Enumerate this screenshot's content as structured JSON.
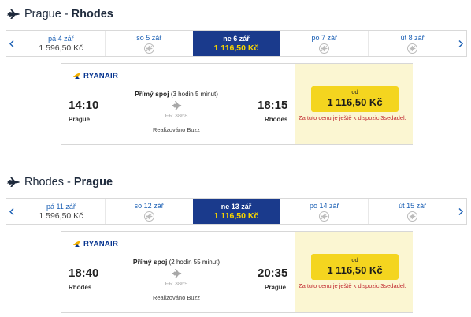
{
  "outbound": {
    "route_from": "Prague",
    "route_sep": " - ",
    "route_to": "Rhodes",
    "dates": [
      {
        "date": "pá 4 zář",
        "price": "1 596,50 Kč",
        "selected": false,
        "no_flight": false
      },
      {
        "date": "so 5 zář",
        "price": "",
        "selected": false,
        "no_flight": true
      },
      {
        "date": "ne 6 zář",
        "price": "1 116,50 Kč",
        "selected": true,
        "no_flight": false
      },
      {
        "date": "po 7 zář",
        "price": "",
        "selected": false,
        "no_flight": true
      },
      {
        "date": "út 8 zář",
        "price": "",
        "selected": false,
        "no_flight": true
      }
    ],
    "airline": "RYANAIR",
    "dep_time": "14:10",
    "dep_city": "Prague",
    "arr_time": "18:15",
    "arr_city": "Rhodes",
    "direct_label": "Přímý spoj",
    "duration": "(3 hodin 5 minut)",
    "flight_no": "FR 3868",
    "operated_by": "Realizováno Buzz",
    "price_from": "od",
    "price": "1 116,50 Kč",
    "availability": "Za tuto cenu je ještě k dispozici3sedadel."
  },
  "inbound": {
    "route_from": "Rhodes",
    "route_sep": " - ",
    "route_to": "Prague",
    "dates": [
      {
        "date": "pá 11 zář",
        "price": "1 596,50 Kč",
        "selected": false,
        "no_flight": false
      },
      {
        "date": "so 12 zář",
        "price": "",
        "selected": false,
        "no_flight": true
      },
      {
        "date": "ne 13 zář",
        "price": "1 116,50 Kč",
        "selected": true,
        "no_flight": false
      },
      {
        "date": "po 14 zář",
        "price": "",
        "selected": false,
        "no_flight": true
      },
      {
        "date": "út 15 zář",
        "price": "",
        "selected": false,
        "no_flight": true
      }
    ],
    "airline": "RYANAIR",
    "dep_time": "18:40",
    "dep_city": "Rhodes",
    "arr_time": "20:35",
    "arr_city": "Prague",
    "direct_label": "Přímý spoj",
    "duration": "(2 hodin 55 minut)",
    "flight_no": "FR 3869",
    "operated_by": "Realizováno Buzz",
    "price_from": "od",
    "price": "1 116,50 Kč",
    "availability": "Za tuto cenu je ještě k dispozici3sedadel."
  },
  "icons": {
    "route": "airplane-icon",
    "prev": "chevron-left-icon",
    "next": "chevron-right-icon",
    "no_flight": "no-flight-icon",
    "logo": "ryanair-harp-logo"
  },
  "colors": {
    "selected_bg": "#1a3a8c",
    "selected_price": "#f5d300",
    "link_blue": "#1a5fb4",
    "price_button": "#f4d51f",
    "price_panel": "#fbf6d2",
    "availability_red": "#c0282f"
  }
}
